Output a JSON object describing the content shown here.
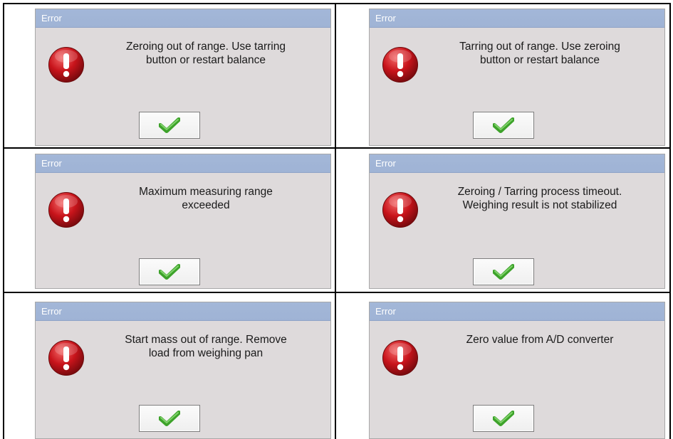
{
  "dialogs": [
    {
      "title": "Error",
      "message_line1": "Zeroing out of range. Use tarring",
      "message_line2": "button or restart balance",
      "icon": "error-exclamation-icon",
      "button_icon": "checkmark-icon"
    },
    {
      "title": "Error",
      "message_line1": "Tarring out of range. Use zeroing",
      "message_line2": "button or restart balance",
      "icon": "error-exclamation-icon",
      "button_icon": "checkmark-icon"
    },
    {
      "title": "Error",
      "message_line1": "Maximum measuring range",
      "message_line2": "exceeded",
      "icon": "error-exclamation-icon",
      "button_icon": "checkmark-icon"
    },
    {
      "title": "Error",
      "message_line1": "Zeroing / Tarring process timeout.",
      "message_line2": "Weighing result is not stabilized",
      "icon": "error-exclamation-icon",
      "button_icon": "checkmark-icon"
    },
    {
      "title": "Error",
      "message_line1": "Start mass out of range. Remove",
      "message_line2": "load from weighing pan",
      "icon": "error-exclamation-icon",
      "button_icon": "checkmark-icon"
    },
    {
      "title": "Error",
      "message_line1": "Zero value from A/D converter",
      "message_line2": "",
      "icon": "error-exclamation-icon",
      "button_icon": "checkmark-icon"
    }
  ],
  "colors": {
    "title_bar": "#a3b7d8",
    "dialog_background": "#dedadb",
    "error_red": "#c8141b",
    "checkmark_green": "#3da22a"
  }
}
